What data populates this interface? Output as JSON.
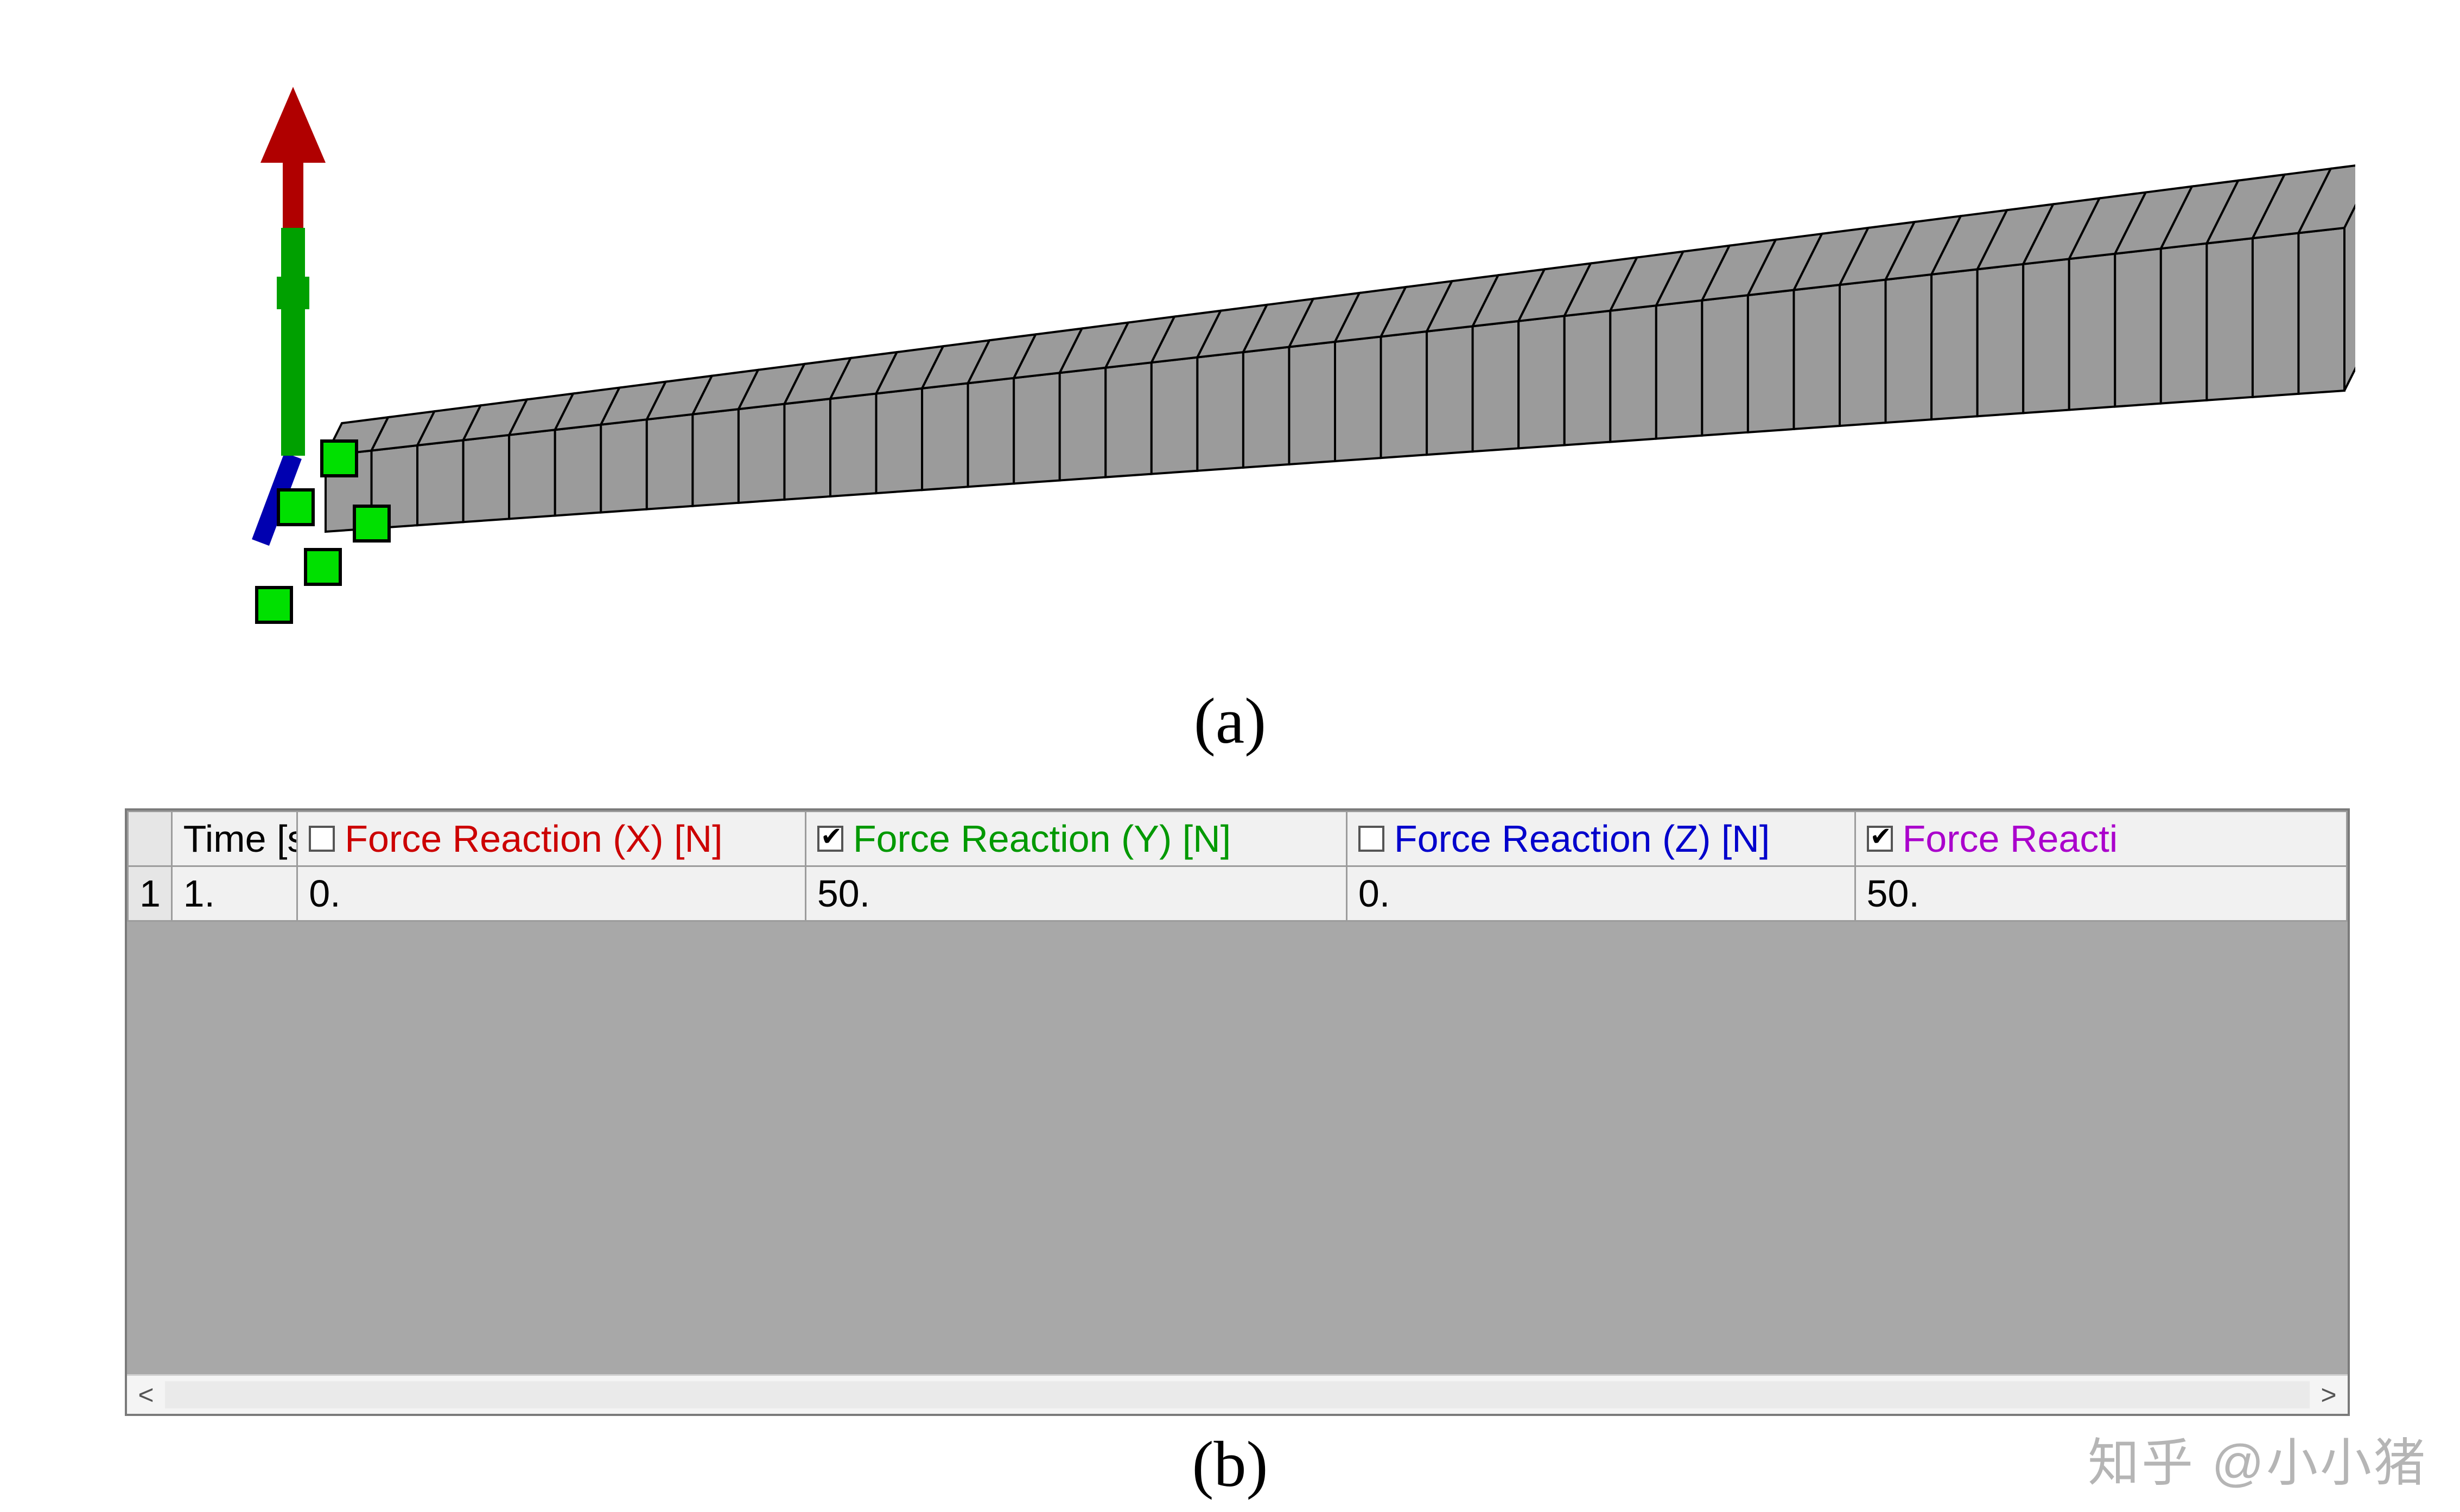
{
  "captions": {
    "a": "(a)",
    "b": "(b)"
  },
  "mesh": {
    "element_count": 44,
    "triad": {
      "x_color": "#0000b0",
      "y_color": "#00a000",
      "z_color": "#b00000"
    },
    "bc_marker_color": "#00e000",
    "beam_fill": "#9b9b9b"
  },
  "table": {
    "headers": {
      "time": {
        "label": "Time [s]"
      },
      "fx": {
        "label": "Force Reaction (X) [N]",
        "checked": false,
        "color": "#cc0000"
      },
      "fy": {
        "label": "Force Reaction (Y) [N]",
        "checked": true,
        "color": "#009900"
      },
      "fz": {
        "label": "Force Reaction (Z) [N]",
        "checked": false,
        "color": "#0000cc"
      },
      "ftotal": {
        "label": "Force Reacti",
        "checked": true,
        "color": "#aa00cc"
      }
    },
    "rows": [
      {
        "idx": "1",
        "time": "1.",
        "fx": "0.",
        "fy": "50.",
        "fz": "0.",
        "ftotal": "50."
      }
    ]
  },
  "scrollbar": {
    "left_glyph": "<",
    "right_glyph": ">"
  },
  "watermark": "知乎 @小小猪"
}
